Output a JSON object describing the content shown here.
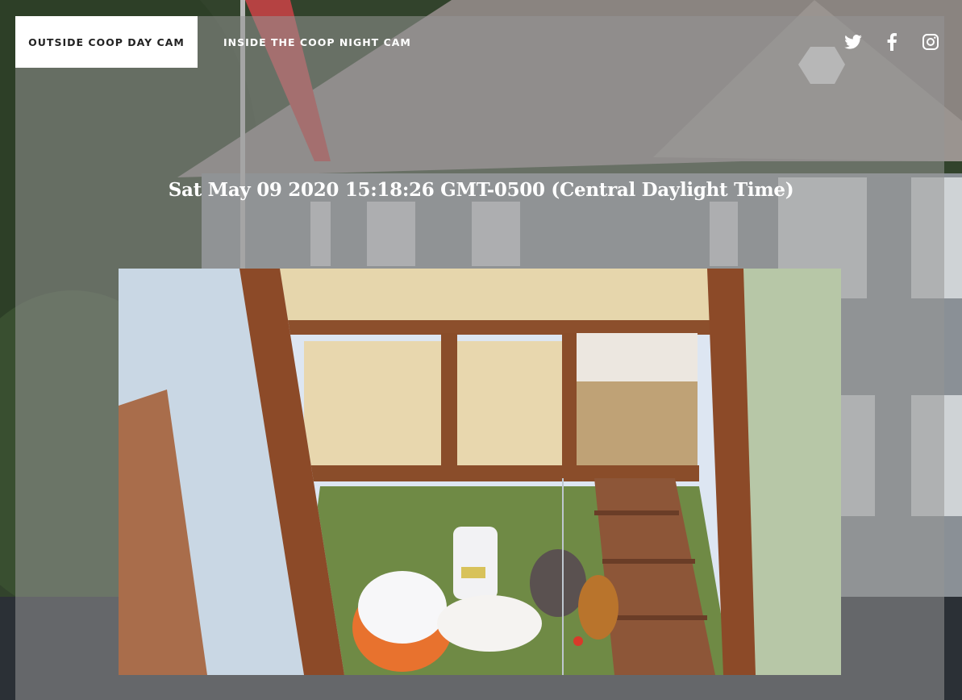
{
  "nav": {
    "items": [
      {
        "label": "OUTSIDE COOP DAY CAM",
        "active": true
      },
      {
        "label": "INSIDE THE COOP NIGHT CAM",
        "active": false
      }
    ],
    "social": [
      "twitter-icon",
      "facebook-icon",
      "instagram-icon"
    ]
  },
  "stream": {
    "timestamp": "Sat May 09 2020 15:18:26 GMT-0500 (Central Daylight Time)",
    "image": "chicken-coop-camera-feed"
  },
  "colors": {
    "panel_overlay": "#969696",
    "active_tab_bg": "#ffffff",
    "text_light": "#ffffff",
    "page_bg": "#262b30"
  }
}
